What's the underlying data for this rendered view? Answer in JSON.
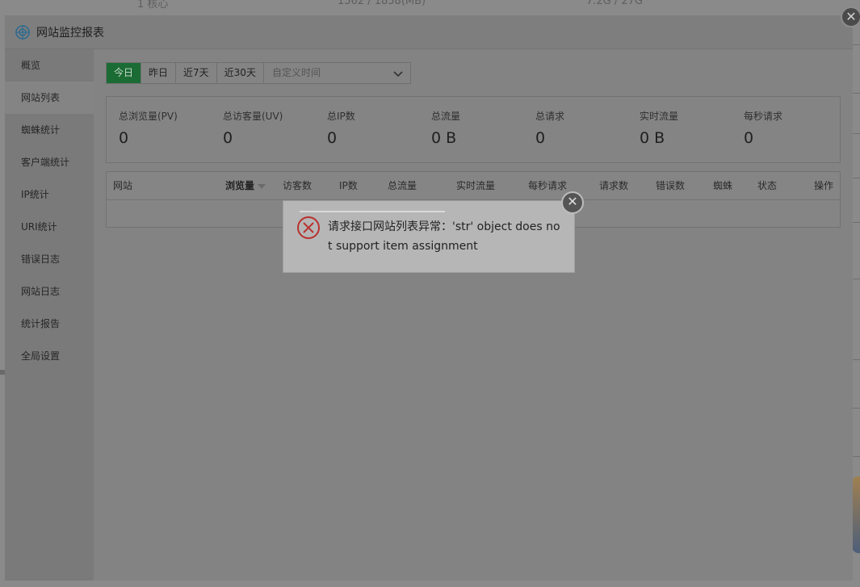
{
  "background": {
    "row_cells": [
      "1 核心",
      "1562 / 1858(MB)",
      "7.2G / 27G"
    ]
  },
  "layer": {
    "title": "网站监控报表",
    "close_glyph": "✕"
  },
  "sidebar": {
    "items": [
      {
        "label": "概览"
      },
      {
        "label": "网站列表"
      },
      {
        "label": "蜘蛛统计"
      },
      {
        "label": "客户端统计"
      },
      {
        "label": "IP统计"
      },
      {
        "label": "URI统计"
      },
      {
        "label": "错误日志"
      },
      {
        "label": "网站日志"
      },
      {
        "label": "统计报告"
      },
      {
        "label": "全局设置"
      }
    ],
    "active_index": 1
  },
  "tabs": {
    "items": [
      {
        "label": "今日"
      },
      {
        "label": "昨日"
      },
      {
        "label": "近7天"
      },
      {
        "label": "近30天"
      }
    ],
    "active_index": 0,
    "custom_time_placeholder": "自定义时间"
  },
  "stats": [
    {
      "label": "总浏览量(PV)",
      "value": "0"
    },
    {
      "label": "总访客量(UV)",
      "value": "0"
    },
    {
      "label": "总IP数",
      "value": "0"
    },
    {
      "label": "总流量",
      "value": "0 B"
    },
    {
      "label": "总请求",
      "value": "0"
    },
    {
      "label": "实时流量",
      "value": "0 B"
    },
    {
      "label": "每秒请求",
      "value": "0"
    }
  ],
  "table": {
    "columns": [
      "网站",
      "浏览量",
      "访客数",
      "IP数",
      "总流量",
      "实时流量",
      "每秒请求",
      "请求数",
      "错误数",
      "蜘蛛",
      "状态",
      "操作"
    ],
    "sorted_column": "浏览量",
    "rows": []
  },
  "message": {
    "text": "请求接口网站列表异常：'str' object does not support item assignment",
    "close_glyph": "✕"
  },
  "colors": {
    "active_tab": "#1b6b34",
    "error_icon": "#b8312f",
    "logo": "#2e6b8e"
  }
}
